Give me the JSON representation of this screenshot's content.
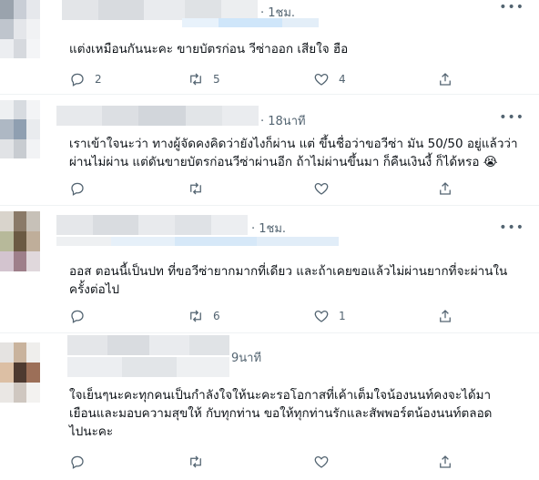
{
  "tweets": [
    {
      "time": "· 1ชม.",
      "text": "แต่งเหมือนกันนะคะ ขายบัตรก่อน วีซ่าออก  เสียใจ ฮือ",
      "reply_count": "2",
      "retweet_count": "5",
      "like_count": "4"
    },
    {
      "time": "· 18นาที",
      "text": "เราเข้าใจนะว่า ทางผู้จัดคงคิดว่ายังไงก็ผ่าน แต่ ขึ้นชื่อว่าขอวีซ่า มัน 50/50 อยู่แล้วว่า\nผ่านไม่ผ่าน แต่ดันขายบัตรก่อนวีซ่าผ่านอีก ถ้าไม่ผ่านขึ้นมา  ก็คืนเงินงี้ ก็ได้หรอ 😭",
      "reply_count": "",
      "retweet_count": "",
      "like_count": ""
    },
    {
      "time": "· 1ชม.",
      "text": "ออส ตอนนี้เป็นปท ที่ขอวีซ่ายากมากที่เดียว และถ้าเคยขอแล้วไม่ผ่านยากที่จะผ่านใน\nครั้งต่อไป",
      "reply_count": "",
      "retweet_count": "6",
      "like_count": "1"
    },
    {
      "time": "9นาที",
      "text": "ใจเย็นๆนะคะทุกคนเป็นกำลังใจให้นะคะรอโอกาสที่เค้าเต็มใจน้องนนท์คงจะได้มา\nเยือนและมอบความสุขให้ กับทุกท่าน ขอให้ทุกท่านรักและสัพพอร์ตน้องนนท์ตลอด\nไปนะคะ",
      "reply_count": "",
      "retweet_count": "",
      "like_count": ""
    }
  ],
  "icons": {
    "reply": "reply-icon",
    "retweet": "retweet-icon",
    "like": "heart-icon",
    "share": "share-icon",
    "more": "more-icon"
  },
  "colors": {
    "text": "#0f1419",
    "muted": "#536471",
    "divider": "#eff3f4"
  }
}
